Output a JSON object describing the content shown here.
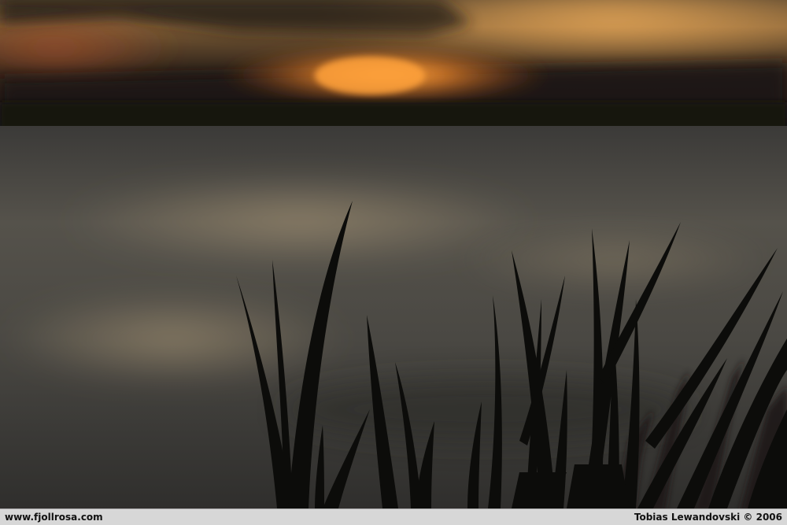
{
  "photo": {
    "subject": "Grass silhouette against sunset over water"
  },
  "footer": {
    "website": "www.fjollrosa.com",
    "credit": "Tobias Lewandovski © 2006"
  },
  "colors": {
    "sun": "#ffa13a",
    "sky_glow": "#f2a04a",
    "water": "#4b4a45",
    "silhouette": "#0c0c0a",
    "footer_bg": "#d7d7d7"
  }
}
